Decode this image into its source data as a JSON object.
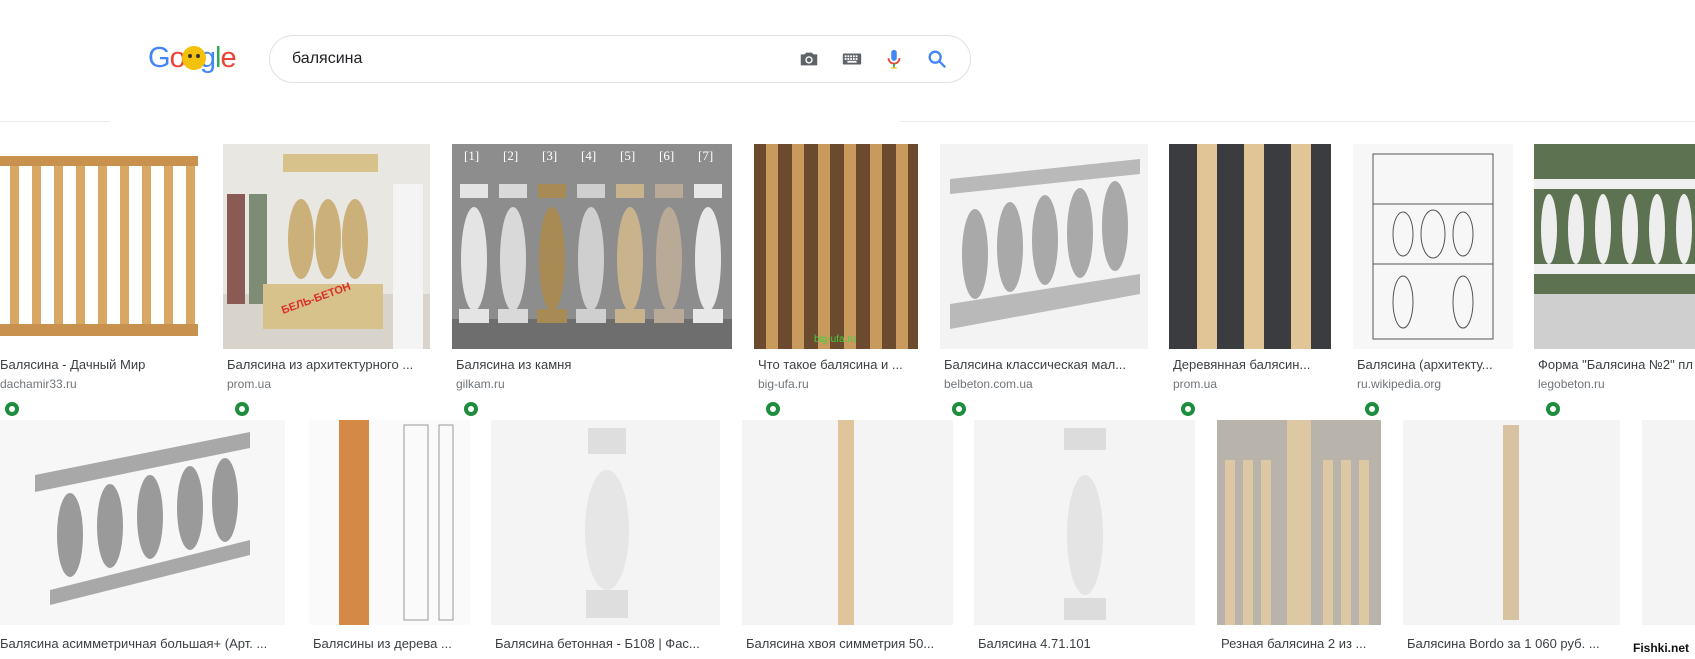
{
  "logo_letters": [
    {
      "ch": "G",
      "color": "#4285f4"
    },
    {
      "ch": "o",
      "color": "#ea4335"
    },
    {
      "ch": "o",
      "color": "#fbbc05"
    },
    {
      "ch": "g",
      "color": "#4285f4"
    },
    {
      "ch": "l",
      "color": "#34a853"
    },
    {
      "ch": "e",
      "color": "#ea4335"
    }
  ],
  "search": {
    "query": "балясина"
  },
  "row1": [
    {
      "caption": "Балясина - Дачный Мир",
      "source": "dachamir33.ru"
    },
    {
      "caption": "Балясина из архитектурного ...",
      "source": "prom.ua"
    },
    {
      "caption": "Балясина из камня",
      "source": "gilkam.ru"
    },
    {
      "caption": "Что такое балясина и ...",
      "source": "big-ufa.ru"
    },
    {
      "caption": "Балясина классическая мал...",
      "source": "belbeton.com.ua"
    },
    {
      "caption": "Деревянная балясин...",
      "source": "prom.ua"
    },
    {
      "caption": "Балясина (архитекту...",
      "source": "ru.wikipedia.org"
    },
    {
      "caption": "Форма \"Балясина №2\" пл",
      "source": "legobeton.ru"
    }
  ],
  "row2": [
    {
      "caption": "Балясина асимметричная большая+ (Арт. ..."
    },
    {
      "caption": "Балясины из дерева ..."
    },
    {
      "caption": "Балясина бетонная - Б108 | Фас..."
    },
    {
      "caption": "Балясина хвоя симметрия 50..."
    },
    {
      "caption": "Балясина 4.71.101"
    },
    {
      "caption": "Резная балясина 2 из ..."
    },
    {
      "caption": "Балясина Bordo за 1 060 руб. ..."
    }
  ],
  "image3_labels": [
    "[1]",
    "[2]",
    "[3]",
    "[4]",
    "[5]",
    "[6]",
    "[7]"
  ],
  "image2_overlay": "БЕЛЬ-БЕТОН",
  "image4_overlay": "big-ufa.ru",
  "watermark": "Fishki.net"
}
